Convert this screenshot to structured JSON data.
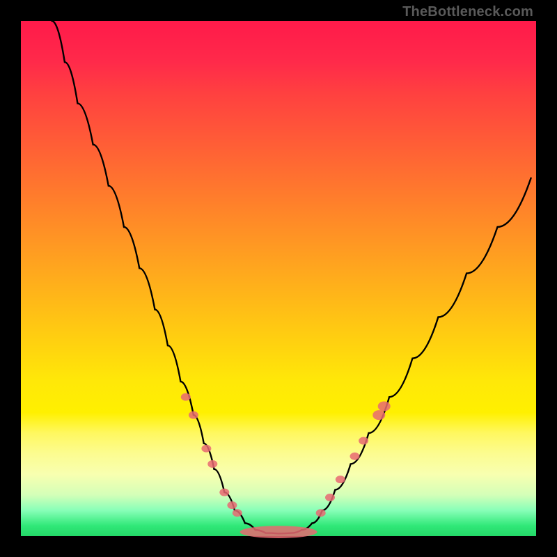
{
  "watermark": "TheBottleneck.com",
  "chart_data": {
    "type": "line",
    "title": "",
    "xlabel": "",
    "ylabel": "",
    "x_range": [
      0,
      1
    ],
    "y_range": [
      0,
      1
    ],
    "curve": [
      {
        "x": 0.06,
        "y": 1.0
      },
      {
        "x": 0.085,
        "y": 0.92
      },
      {
        "x": 0.11,
        "y": 0.84
      },
      {
        "x": 0.14,
        "y": 0.76
      },
      {
        "x": 0.17,
        "y": 0.68
      },
      {
        "x": 0.2,
        "y": 0.6
      },
      {
        "x": 0.23,
        "y": 0.52
      },
      {
        "x": 0.26,
        "y": 0.44
      },
      {
        "x": 0.285,
        "y": 0.37
      },
      {
        "x": 0.31,
        "y": 0.3
      },
      {
        "x": 0.335,
        "y": 0.235
      },
      {
        "x": 0.355,
        "y": 0.18
      },
      {
        "x": 0.375,
        "y": 0.13
      },
      {
        "x": 0.395,
        "y": 0.085
      },
      {
        "x": 0.415,
        "y": 0.05
      },
      {
        "x": 0.435,
        "y": 0.025
      },
      {
        "x": 0.455,
        "y": 0.012
      },
      {
        "x": 0.475,
        "y": 0.006
      },
      {
        "x": 0.5,
        "y": 0.005
      },
      {
        "x": 0.525,
        "y": 0.006
      },
      {
        "x": 0.545,
        "y": 0.012
      },
      {
        "x": 0.565,
        "y": 0.025
      },
      {
        "x": 0.585,
        "y": 0.05
      },
      {
        "x": 0.61,
        "y": 0.09
      },
      {
        "x": 0.64,
        "y": 0.14
      },
      {
        "x": 0.675,
        "y": 0.2
      },
      {
        "x": 0.715,
        "y": 0.27
      },
      {
        "x": 0.76,
        "y": 0.345
      },
      {
        "x": 0.81,
        "y": 0.425
      },
      {
        "x": 0.865,
        "y": 0.51
      },
      {
        "x": 0.925,
        "y": 0.6
      },
      {
        "x": 0.99,
        "y": 0.695
      }
    ],
    "dots_left": [
      {
        "x": 0.32,
        "y": 0.27,
        "r": 7
      },
      {
        "x": 0.335,
        "y": 0.235,
        "r": 7
      },
      {
        "x": 0.36,
        "y": 0.17,
        "r": 7
      },
      {
        "x": 0.372,
        "y": 0.14,
        "r": 7
      },
      {
        "x": 0.395,
        "y": 0.085,
        "r": 7
      },
      {
        "x": 0.41,
        "y": 0.06,
        "r": 7
      },
      {
        "x": 0.42,
        "y": 0.045,
        "r": 7
      }
    ],
    "dots_right": [
      {
        "x": 0.582,
        "y": 0.045,
        "r": 7
      },
      {
        "x": 0.6,
        "y": 0.075,
        "r": 7
      },
      {
        "x": 0.62,
        "y": 0.11,
        "r": 7
      },
      {
        "x": 0.648,
        "y": 0.155,
        "r": 7
      },
      {
        "x": 0.665,
        "y": 0.185,
        "r": 7
      },
      {
        "x": 0.695,
        "y": 0.235,
        "r": 9
      },
      {
        "x": 0.705,
        "y": 0.252,
        "r": 9
      }
    ],
    "bottom_blob": {
      "cx": 0.5,
      "cy": 0.008,
      "rx": 0.075,
      "ry": 0.012
    },
    "legend": [],
    "grid": false
  }
}
